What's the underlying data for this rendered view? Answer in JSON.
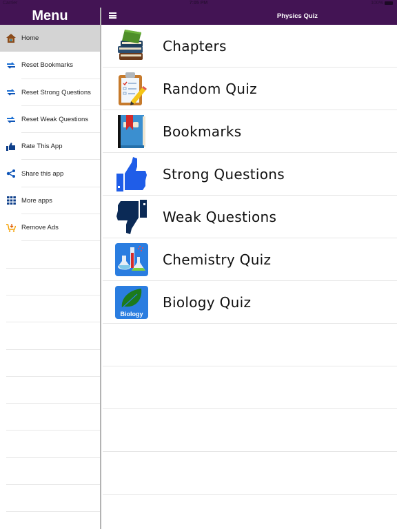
{
  "status_bar": {
    "carrier": "Carrier",
    "time": "7:05 PM",
    "battery": "100%"
  },
  "sidebar": {
    "title": "Menu",
    "items": [
      {
        "label": "Home",
        "icon": "home-icon",
        "active": true
      },
      {
        "label": "Reset Bookmarks",
        "icon": "reset-arrows-icon"
      },
      {
        "label": "Reset Strong Questions",
        "icon": "reset-arrows-icon"
      },
      {
        "label": "Reset Weak Questions",
        "icon": "reset-arrows-icon"
      },
      {
        "label": "Rate This App",
        "icon": "thumbs-up-icon"
      },
      {
        "label": "Share this app",
        "icon": "share-icon"
      },
      {
        "label": "More apps",
        "icon": "grid-icon"
      },
      {
        "label": "Remove Ads",
        "icon": "cart-icon"
      }
    ]
  },
  "header": {
    "title": "Physics Quiz",
    "menu_icon": "hamburger-icon"
  },
  "main": {
    "items": [
      {
        "label": "Chapters",
        "icon": "books-icon"
      },
      {
        "label": "Random Quiz",
        "icon": "clipboard-pencil-icon"
      },
      {
        "label": "Bookmarks",
        "icon": "bookmark-book-icon"
      },
      {
        "label": "Strong Questions",
        "icon": "thumbs-up-icon"
      },
      {
        "label": "Weak Questions",
        "icon": "thumbs-down-icon"
      },
      {
        "label": "Chemistry Quiz",
        "icon": "flasks-icon"
      },
      {
        "label": "Biology Quiz",
        "icon": "leaf-icon",
        "badge_text": "Biology"
      }
    ]
  },
  "colors": {
    "header_bg": "#431454",
    "active_row": "#d4d4d4",
    "icon_blue": "#1a5fd4",
    "icon_navy": "#0e2a5a",
    "icon_orange": "#f5a000"
  }
}
